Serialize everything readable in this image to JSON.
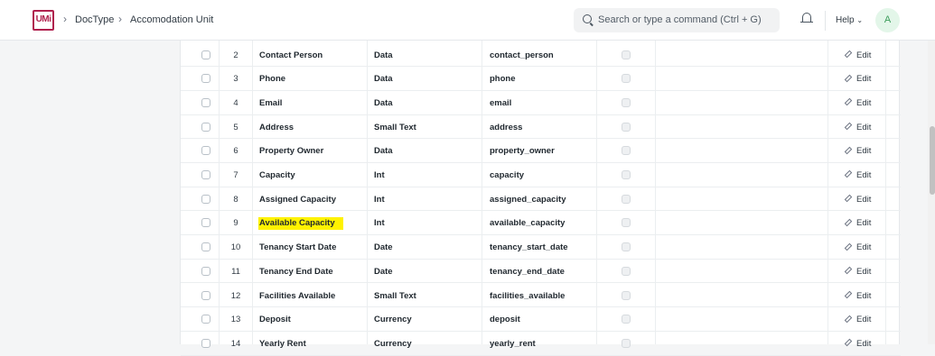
{
  "navbar": {
    "logo_text": "UMi",
    "breadcrumbs": [
      "DocType",
      "Accomodation Unit"
    ],
    "search": {
      "placeholder": "Search or type a command (Ctrl + G)"
    },
    "help_label": "Help",
    "avatar_initial": "A"
  },
  "table": {
    "edit_label": "Edit",
    "rows": [
      {
        "idx": "2",
        "label": "Contact Person",
        "type": "Data",
        "fieldname": "contact_person"
      },
      {
        "idx": "3",
        "label": "Phone",
        "type": "Data",
        "fieldname": "phone"
      },
      {
        "idx": "4",
        "label": "Email",
        "type": "Data",
        "fieldname": "email"
      },
      {
        "idx": "5",
        "label": "Address",
        "type": "Small Text",
        "fieldname": "address"
      },
      {
        "idx": "6",
        "label": "Property Owner",
        "type": "Data",
        "fieldname": "property_owner"
      },
      {
        "idx": "7",
        "label": "Capacity",
        "type": "Int",
        "fieldname": "capacity"
      },
      {
        "idx": "8",
        "label": "Assigned Capacity",
        "type": "Int",
        "fieldname": "assigned_capacity"
      },
      {
        "idx": "9",
        "label": "Available Capacity",
        "type": "Int",
        "fieldname": "available_capacity",
        "highlighted": true
      },
      {
        "idx": "10",
        "label": "Tenancy Start Date",
        "type": "Date",
        "fieldname": "tenancy_start_date"
      },
      {
        "idx": "11",
        "label": "Tenancy End Date",
        "type": "Date",
        "fieldname": "tenancy_end_date"
      },
      {
        "idx": "12",
        "label": "Facilities Available",
        "type": "Small Text",
        "fieldname": "facilities_available"
      },
      {
        "idx": "13",
        "label": "Deposit",
        "type": "Currency",
        "fieldname": "deposit"
      },
      {
        "idx": "14",
        "label": "Yearly Rent",
        "type": "Currency",
        "fieldname": "yearly_rent"
      }
    ]
  },
  "colors": {
    "highlight": "#fff200",
    "brand": "#b0214e"
  }
}
